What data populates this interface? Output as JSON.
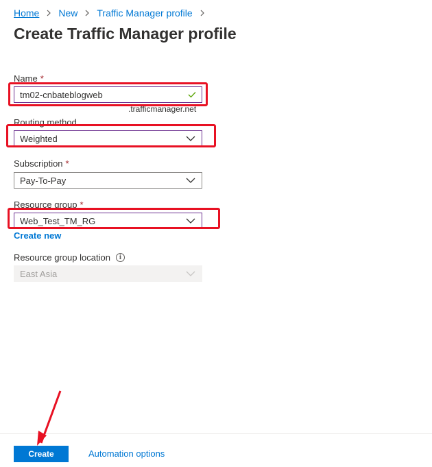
{
  "breadcrumb": {
    "home": "Home",
    "new": "New",
    "profile": "Traffic Manager profile"
  },
  "page": {
    "title": "Create Traffic Manager profile"
  },
  "form": {
    "name": {
      "label": "Name",
      "required_mark": "*",
      "value": "tm02-cnbateblogweb",
      "suffix": ".trafficmanager.net"
    },
    "routing_method": {
      "label": "Routing method",
      "value": "Weighted"
    },
    "subscription": {
      "label": "Subscription",
      "required_mark": "*",
      "value": "Pay-To-Pay"
    },
    "resource_group": {
      "label": "Resource group",
      "required_mark": "*",
      "value": "Web_Test_TM_RG",
      "create_new": "Create new"
    },
    "resource_group_location": {
      "label": "Resource group location",
      "value": "East Asia"
    }
  },
  "footer": {
    "create_label": "Create",
    "automation_label": "Automation options"
  },
  "colors": {
    "accent": "#0078d4",
    "highlight": "#e81123",
    "required": "#a4262c",
    "focus_border": "#6b2f8f",
    "valid_check": "#57a300"
  },
  "icons": {
    "breadcrumb_separator": "chevron-right-icon",
    "dropdown": "chevron-down-icon",
    "validation": "checkmark-icon",
    "info": "info-icon"
  }
}
